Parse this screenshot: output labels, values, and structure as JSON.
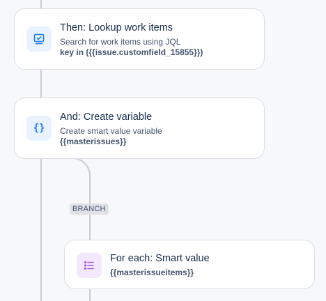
{
  "steps": [
    {
      "title": "Then: Lookup work items",
      "description": "Search for work items using JQL",
      "code": "key in ({{issue.customfield_15855}})",
      "icon": "lookup-icon"
    },
    {
      "title": "And: Create variable",
      "description": "Create smart value variable",
      "code": "{{masterissues}}",
      "icon": "braces-icon"
    }
  ],
  "branch": {
    "label": "BRANCH",
    "card": {
      "title": "For each: Smart value",
      "code": "{{masterissueitems}}",
      "icon": "list-icon"
    }
  },
  "colors": {
    "accent_blue": "#1d7afc",
    "accent_purple": "#9f5fd9",
    "rail": "#c9ccd1"
  }
}
